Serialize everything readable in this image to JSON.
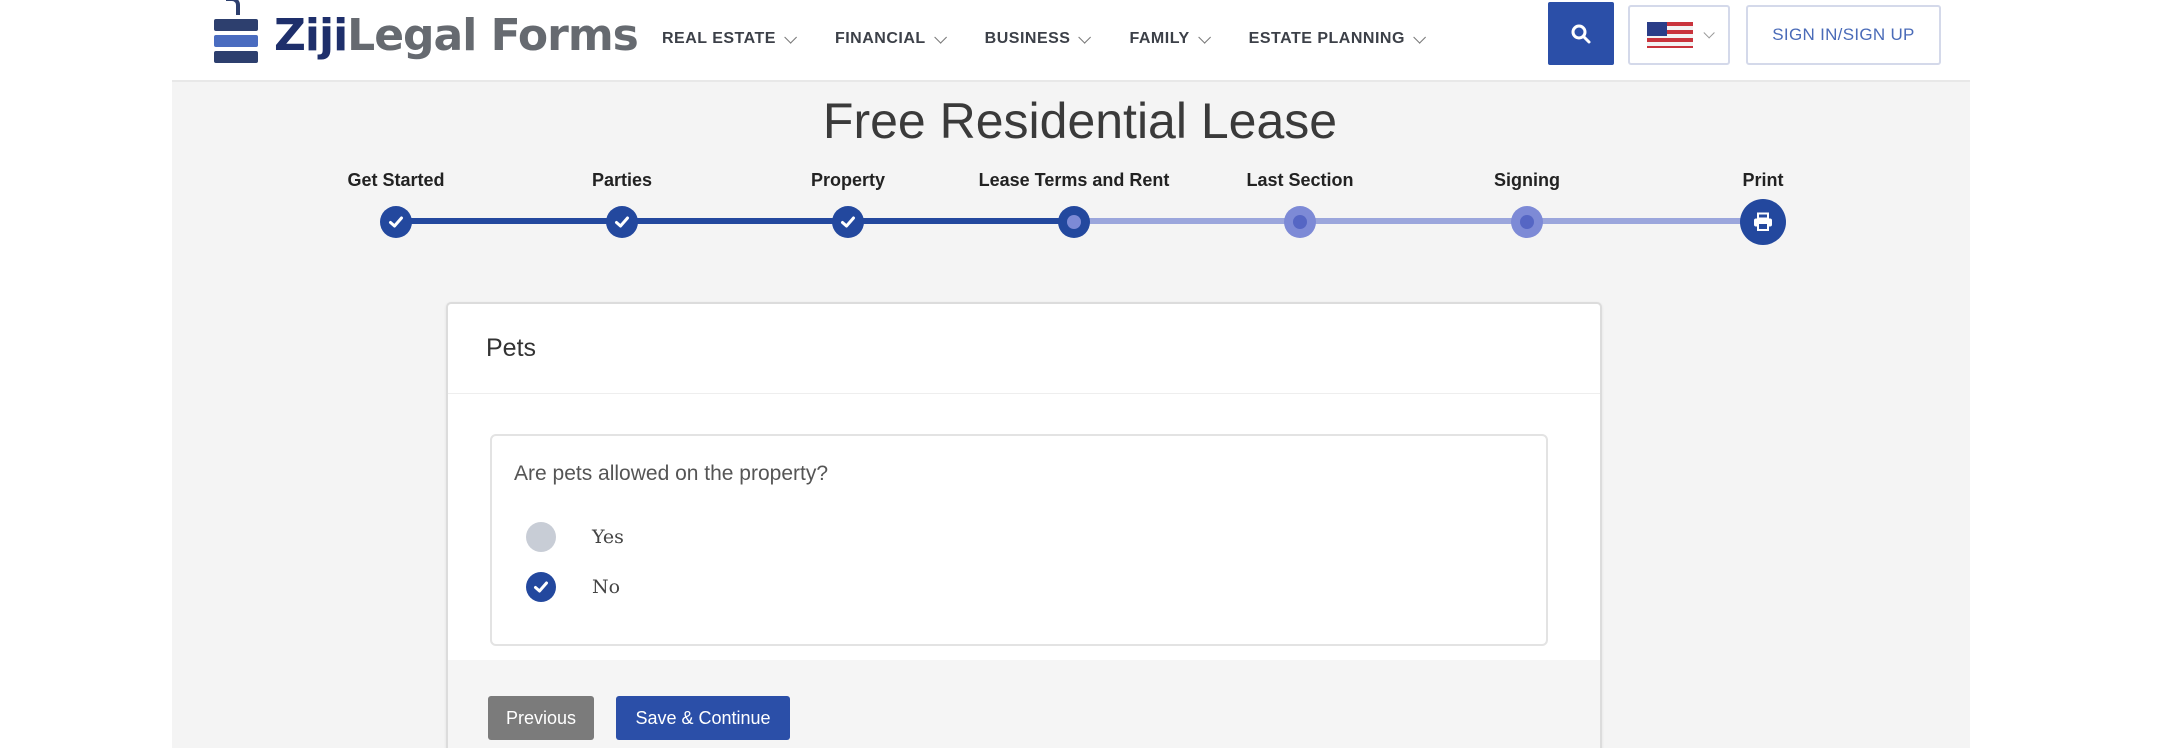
{
  "brand": {
    "part1": "Ziji",
    "part2": "Legal Forms"
  },
  "nav": {
    "items": [
      {
        "label": "REAL ESTATE"
      },
      {
        "label": "FINANCIAL"
      },
      {
        "label": "BUSINESS"
      },
      {
        "label": "FAMILY"
      },
      {
        "label": "ESTATE PLANNING"
      }
    ],
    "signin_label": "SIGN IN/SIGN UP",
    "search_icon": "search-icon",
    "language_icon": "us-flag-icon"
  },
  "page": {
    "title": "Free Residential Lease"
  },
  "stepper": {
    "steps": [
      {
        "label": "Get Started",
        "state": "done"
      },
      {
        "label": "Parties",
        "state": "done"
      },
      {
        "label": "Property",
        "state": "done"
      },
      {
        "label": "Lease Terms and Rent",
        "state": "current"
      },
      {
        "label": "Last Section",
        "state": "todo"
      },
      {
        "label": "Signing",
        "state": "todo"
      },
      {
        "label": "Print",
        "state": "print"
      }
    ]
  },
  "card": {
    "title": "Pets",
    "question": "Are pets allowed on the property?",
    "options": [
      {
        "label": "Yes",
        "selected": false
      },
      {
        "label": "No",
        "selected": true
      }
    ],
    "previous_label": "Previous",
    "save_label": "Save & Continue"
  },
  "colors": {
    "primary": "#2b4fa8",
    "progress_done": "#23489e",
    "progress_todo": "#9ba6dc",
    "secondary_button": "#7b7b7b"
  }
}
